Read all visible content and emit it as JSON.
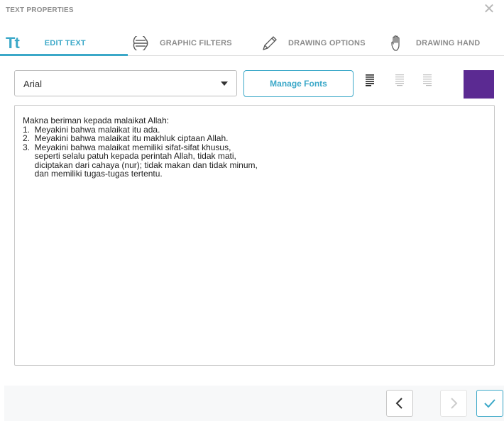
{
  "dialog": {
    "title": "TEXT PROPERTIES",
    "close_icon": "close-icon"
  },
  "tabs": [
    {
      "label": "EDIT TEXT",
      "icon": "text-tt-icon",
      "active": true
    },
    {
      "label": "GRAPHIC FILTERS",
      "icon": "graphic-filters-icon",
      "active": false
    },
    {
      "label": "DRAWING OPTIONS",
      "icon": "pencil-icon",
      "active": false
    },
    {
      "label": "DRAWING HAND",
      "icon": "hand-icon",
      "active": false
    }
  ],
  "toolbar": {
    "font_value": "Arial",
    "manage_fonts_label": "Manage Fonts",
    "alignment_selected": "left",
    "text_color": "#5b2a92"
  },
  "text_content": {
    "lines": [
      "Makna beriman kepada malaikat Allah:",
      "1.  Meyakini bahwa malaikat itu ada.",
      "2.  Meyakini bahwa malaikat itu makhluk ciptaan Allah.",
      "3.  Meyakini bahwa malaikat memiliki sifat-sifat khusus,",
      "     seperti selalu patuh kepada perintah Allah, tidak mati,",
      "     diciptakan dari cahaya (nur); tidak makan dan tidak minum,",
      "     dan memiliki tugas-tugas tertentu."
    ]
  },
  "footer": {
    "prev_icon": "chevron-left-icon",
    "next_icon": "chevron-right-icon",
    "confirm_icon": "checkmark-icon"
  },
  "colors": {
    "accent": "#3ba8c8",
    "swatch": "#5b2a92"
  }
}
